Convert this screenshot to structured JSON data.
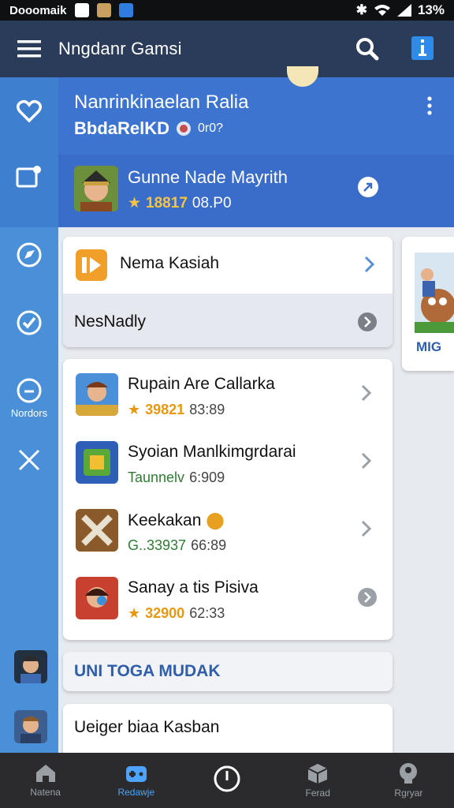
{
  "status_bar": {
    "carrier": "Dooomaik",
    "battery": "13%"
  },
  "app_bar": {
    "title": "Nngdanr Gamsi"
  },
  "header": {
    "title": "Nanrinkinaelan Ralia",
    "subtitle": "BbdaRelKD",
    "subtitle_meta": "0r0?",
    "featured": {
      "title": "Gunne Nade Mayrith",
      "rating": "18817",
      "time": "08.P0"
    }
  },
  "rail": {
    "label": "Nordors"
  },
  "card1": {
    "row1_title": "Nema Kasiah",
    "row2_title": "NesNadly"
  },
  "side_card": {
    "label": "MIG"
  },
  "games": [
    {
      "name": "Rupain Are Callarka",
      "rating": "39821",
      "time": "83:89",
      "style": "orange"
    },
    {
      "name": "Syoian Manlkimgrdarai",
      "rating": "Taunnelv",
      "time": "6:909",
      "style": "green"
    },
    {
      "name": "Keekakan",
      "rating": "G..33937",
      "time": "66:89",
      "style": "green"
    },
    {
      "name": "Sanay a tis Pisiva",
      "rating": "32900",
      "time": "62:33",
      "style": "orange"
    }
  ],
  "section": {
    "title": "UNI TOGA MUDAK"
  },
  "card3": {
    "title": "Ueiger biaa Kasban"
  },
  "bottom_nav": [
    {
      "label": "Natena"
    },
    {
      "label": "Redawje"
    },
    {
      "label": ""
    },
    {
      "label": "Ferad"
    },
    {
      "label": "Rgryar"
    }
  ],
  "colors": {
    "appbar": "#2b3c5a",
    "rail": "#4a90d9",
    "header": "#3c74cf",
    "accent": "#4da3ff"
  }
}
